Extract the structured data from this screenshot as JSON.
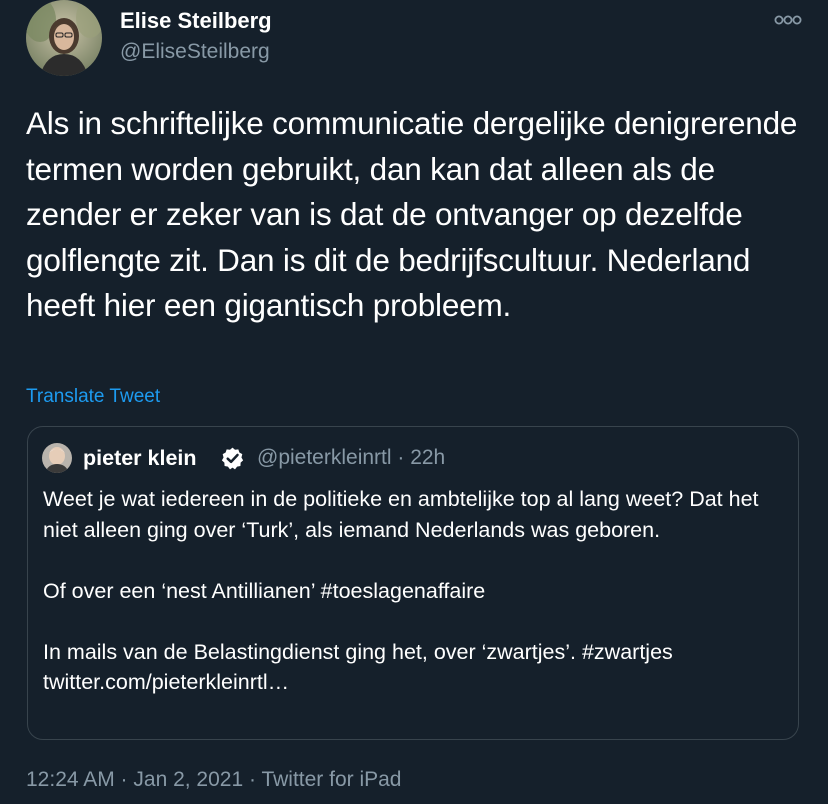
{
  "author": {
    "name": "Elise Steilberg",
    "handle": "@EliseSteilberg",
    "avatar_icon": "profile-photo-icon"
  },
  "more_menu_icon": "more-options-icon",
  "tweet": {
    "text": "Als in schriftelijke communicatie dergelijke denigrerende termen worden gebruikt, dan kan dat alleen als de zender er zeker van is dat de ontvanger op dezelfde golflengte zit. Dan is dit de bedrijfscultuur. Nederland heeft hier een gigantisch probleem.",
    "translate_label": "Translate Tweet"
  },
  "quoted_tweet": {
    "name": "pieter klein",
    "handle_time": "@pieterkleinrtl · 22h",
    "verified_icon": "verified-badge-icon",
    "paragraphs": [
      "Weet je wat iedereen in de politieke en ambtelijke top al lang weet? Dat het niet alleen ging over ‘Turk’, als iemand Nederlands was geboren.",
      "Of over een ‘nest Antillianen’ #toeslagenaffaire",
      "In mails van de Belastingdienst ging het, over ‘zwartjes’. #zwartjes twitter.com/pieterkleinrtl…"
    ]
  },
  "meta": {
    "timestamp": "12:24 AM · Jan 2, 2021 · ",
    "source": "Twitter for iPad"
  },
  "colors": {
    "background": "#15202b",
    "text_primary": "#ffffff",
    "text_secondary": "#8899a6",
    "accent": "#1d9bf0",
    "border": "#38444d"
  }
}
